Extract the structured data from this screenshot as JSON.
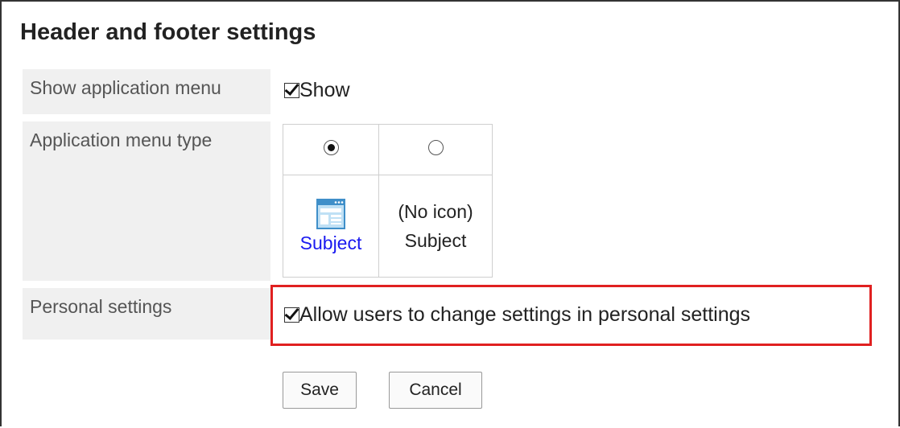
{
  "page": {
    "title": "Header and footer settings"
  },
  "rows": {
    "show_menu": {
      "label": "Show application menu",
      "checkbox_label": "Show",
      "checked": true
    },
    "menu_type": {
      "label": "Application menu type",
      "options": [
        {
          "selected": true,
          "icon": "app-window-icon",
          "caption": "Subject"
        },
        {
          "selected": false,
          "caption_line1": "(No icon)",
          "caption_line2": "Subject"
        }
      ]
    },
    "personal": {
      "label": "Personal settings",
      "checkbox_label": "Allow users to change settings in personal settings",
      "checked": true
    }
  },
  "buttons": {
    "save": "Save",
    "cancel": "Cancel"
  },
  "colors": {
    "highlight": "#e02020",
    "link": "#1a1af0",
    "label_bg": "#f0f0f0"
  }
}
